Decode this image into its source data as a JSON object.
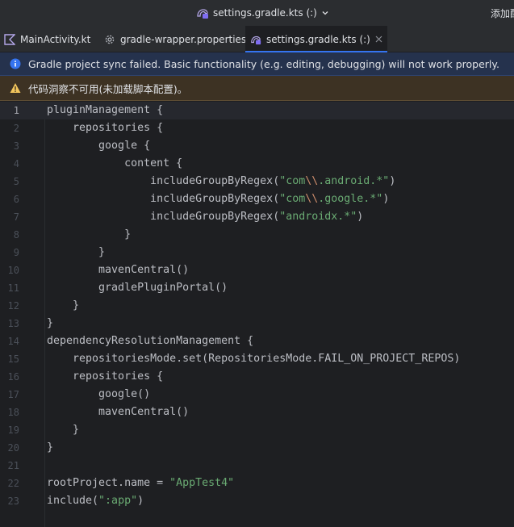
{
  "window": {
    "title": "settings.gradle.kts (:)",
    "right_label": "添加配"
  },
  "tabs": [
    {
      "label": "MainActivity.kt",
      "icon": "kotlin-file-icon"
    },
    {
      "label": "gradle-wrapper.properties",
      "icon": "gear-icon"
    },
    {
      "label": "settings.gradle.kts (:)",
      "icon": "gradle-kts-file-icon",
      "active": true
    }
  ],
  "banners": {
    "info": "Gradle project sync failed. Basic functionality (e.g. editing, debugging) will not work properly.",
    "warning": "代码洞察不可用(未加载脚本配置)。"
  },
  "colors": {
    "accent": "#3574f0",
    "string": "#6aab73",
    "escape": "#cf8e6d",
    "code_text": "#bcbec4",
    "info_icon": "#3574f0",
    "warning_icon": "#f2c55c"
  },
  "editor": {
    "current_line": 1,
    "lines": [
      {
        "num": "1",
        "parts": [
          {
            "t": "pluginManagement {"
          }
        ]
      },
      {
        "num": "2",
        "parts": [
          {
            "t": "    repositories {"
          }
        ]
      },
      {
        "num": "3",
        "parts": [
          {
            "t": "        google {"
          }
        ]
      },
      {
        "num": "4",
        "parts": [
          {
            "t": "            content {"
          }
        ]
      },
      {
        "num": "5",
        "parts": [
          {
            "t": "                includeGroupByRegex("
          },
          {
            "t": "\"com",
            "c": "str"
          },
          {
            "t": "\\\\",
            "c": "esc"
          },
          {
            "t": ".android.*\"",
            "c": "str"
          },
          {
            "t": ")"
          }
        ]
      },
      {
        "num": "6",
        "parts": [
          {
            "t": "                includeGroupByRegex("
          },
          {
            "t": "\"com",
            "c": "str"
          },
          {
            "t": "\\\\",
            "c": "esc"
          },
          {
            "t": ".google.*\"",
            "c": "str"
          },
          {
            "t": ")"
          }
        ]
      },
      {
        "num": "7",
        "parts": [
          {
            "t": "                includeGroupByRegex("
          },
          {
            "t": "\"androidx.*\"",
            "c": "str"
          },
          {
            "t": ")"
          }
        ]
      },
      {
        "num": "8",
        "parts": [
          {
            "t": "            }"
          }
        ]
      },
      {
        "num": "9",
        "parts": [
          {
            "t": "        }"
          }
        ]
      },
      {
        "num": "10",
        "parts": [
          {
            "t": "        mavenCentral()"
          }
        ]
      },
      {
        "num": "11",
        "parts": [
          {
            "t": "        gradlePluginPortal()"
          }
        ]
      },
      {
        "num": "12",
        "parts": [
          {
            "t": "    }"
          }
        ]
      },
      {
        "num": "13",
        "parts": [
          {
            "t": "}"
          }
        ]
      },
      {
        "num": "14",
        "parts": [
          {
            "t": "dependencyResolutionManagement {"
          }
        ]
      },
      {
        "num": "15",
        "parts": [
          {
            "t": "    repositoriesMode.set(RepositoriesMode.FAIL_ON_PROJECT_REPOS)"
          }
        ]
      },
      {
        "num": "16",
        "parts": [
          {
            "t": "    repositories {"
          }
        ]
      },
      {
        "num": "17",
        "parts": [
          {
            "t": "        google()"
          }
        ]
      },
      {
        "num": "18",
        "parts": [
          {
            "t": "        mavenCentral()"
          }
        ]
      },
      {
        "num": "19",
        "parts": [
          {
            "t": "    }"
          }
        ]
      },
      {
        "num": "20",
        "parts": [
          {
            "t": "}"
          }
        ]
      },
      {
        "num": "21",
        "parts": [
          {
            "t": ""
          }
        ]
      },
      {
        "num": "22",
        "parts": [
          {
            "t": "rootProject.name = "
          },
          {
            "t": "\"AppTest4\"",
            "c": "str"
          }
        ]
      },
      {
        "num": "23",
        "parts": [
          {
            "t": "include("
          },
          {
            "t": "\":app\"",
            "c": "str"
          },
          {
            "t": ")"
          }
        ]
      }
    ]
  }
}
